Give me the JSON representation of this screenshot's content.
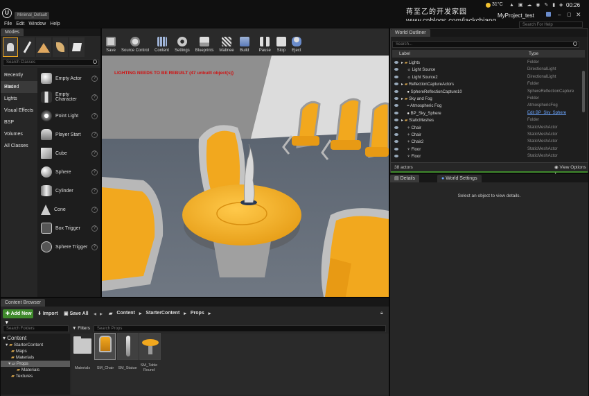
{
  "titlebar": {
    "logo": "U",
    "tab": "Minimal_Default",
    "watermark_title": "蒋至乙的开发家园",
    "watermark_url": "www.cnblogs.com/jackchiang",
    "project": "MyProject_test",
    "temperature": "31°C",
    "time": "00:26",
    "help_search_placeholder": "Search For Help"
  },
  "menu": [
    "File",
    "Edit",
    "Window",
    "Help"
  ],
  "modes": {
    "tab": "Modes",
    "search_placeholder": "Search Classes",
    "categories": [
      "Recently Placed",
      "Basic",
      "Lights",
      "Visual Effects",
      "BSP",
      "Volumes",
      "All Classes"
    ],
    "items": [
      "Empty Actor",
      "Empty Character",
      "Point Light",
      "Player Start",
      "Cube",
      "Sphere",
      "Cylinder",
      "Cone",
      "Box Trigger",
      "Sphere Trigger"
    ],
    "help_glyph": "?"
  },
  "toolbar": {
    "buttons": [
      "Save",
      "Source Control",
      "Content",
      "Settings",
      "Blueprints",
      "Matinee",
      "Build",
      "Pause",
      "Stop",
      "Eject"
    ]
  },
  "viewport": {
    "warning": "LIGHTING NEEDS TO BE REBUILT (47 unbuilt object(s))"
  },
  "outliner": {
    "tab": "World Outliner",
    "search_placeholder": "Search...",
    "col_label": "Label",
    "col_type": "Type",
    "rows": [
      {
        "label": "Lights",
        "type": "Folder"
      },
      {
        "label": "Light Source",
        "type": "DirectionalLight"
      },
      {
        "label": "Light Source2",
        "type": "DirectionalLight"
      },
      {
        "label": "ReflectionCaptureActors",
        "type": "Folder"
      },
      {
        "label": "SphereReflectionCapture10",
        "type": "SphereReflectionCapture"
      },
      {
        "label": "Sky and Fog",
        "type": "Folder"
      },
      {
        "label": "Atmospheric Fog",
        "type": "AtmosphericFog"
      },
      {
        "label": "BP_Sky_Sphere",
        "type": "Edit BP_Sky_Sphere"
      },
      {
        "label": "StaticMeshes",
        "type": "Folder"
      },
      {
        "label": "Chair",
        "type": "StaticMeshActor"
      },
      {
        "label": "Chair",
        "type": "StaticMeshActor"
      },
      {
        "label": "Chair2",
        "type": "StaticMeshActor"
      },
      {
        "label": "Floor",
        "type": "StaticMeshActor"
      },
      {
        "label": "Floor",
        "type": "StaticMeshActor"
      }
    ],
    "count": "38 actors",
    "view_options": "View Options"
  },
  "details": {
    "tab_details": "Details",
    "tab_world_settings": "World Settings",
    "empty_message": "Select an object to view details."
  },
  "content_browser": {
    "tab": "Content Browser",
    "add_new": "Add New",
    "import": "Import",
    "save_all": "Save All",
    "breadcrumb": [
      "Content",
      "StarterContent",
      "Props"
    ],
    "folder_search_placeholder": "Search Folders",
    "filters": "Filters",
    "asset_search_placeholder": "Search Props",
    "tree": [
      "Content",
      "StarterContent",
      "Maps",
      "Materials",
      "Props",
      "Materials",
      "Textures"
    ],
    "assets": [
      "Materials",
      "SM_Chair",
      "SM_Statue",
      "SM_Table Round"
    ]
  },
  "colors": {
    "accent_orange": "#f2a81e",
    "add_new_green": "#3f8a2c",
    "warning_red": "#d01010",
    "link_blue": "#6ba5ff"
  }
}
